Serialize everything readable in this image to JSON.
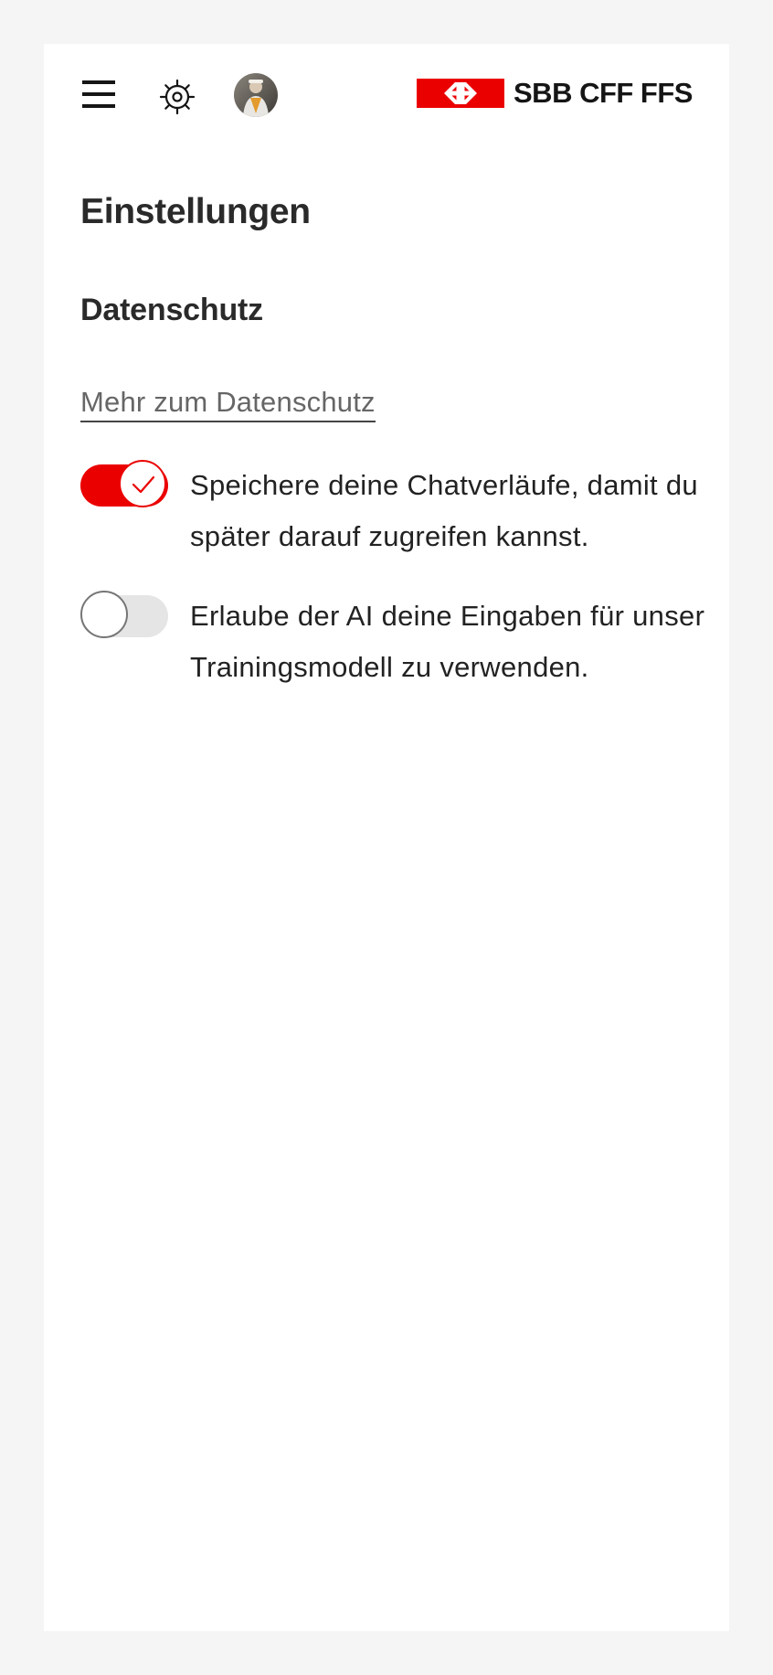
{
  "header": {
    "menu_icon": "hamburger-menu-icon",
    "settings_icon": "gear-icon",
    "avatar_icon": "user-avatar",
    "logo_text": "SBB CFF FFS",
    "brand_color": "#eb0000"
  },
  "page": {
    "title": "Einstellungen"
  },
  "privacy": {
    "section_title": "Datenschutz",
    "link_label": "Mehr zum Datenschutz",
    "settings": [
      {
        "label": "Speichere deine Chatverläufe, damit du später darauf zugreifen kannst.",
        "enabled": true
      },
      {
        "label": "Erlaube der AI deine Eingaben für unser Trainingsmodell zu verwenden.",
        "enabled": false
      }
    ]
  }
}
